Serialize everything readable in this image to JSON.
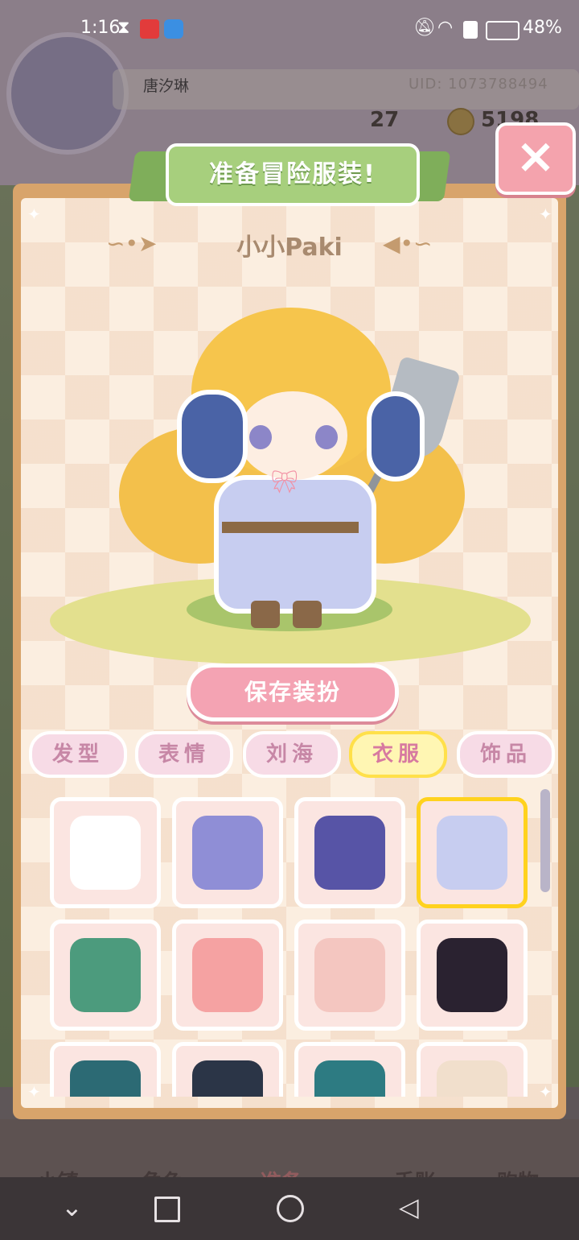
{
  "status_bar": {
    "time": "1:16",
    "battery": "48%"
  },
  "profile": {
    "username": "唐汐琳",
    "uid": "UID: 1073788494",
    "level": "27",
    "coins": "5198"
  },
  "dialog": {
    "title": "准备冒险服装!",
    "character_name": "小小Paki",
    "save_label": "保存装扮",
    "close_label": "×"
  },
  "tabs": [
    {
      "label": "发型",
      "active": false
    },
    {
      "label": "表情",
      "active": false
    },
    {
      "label": "刘海",
      "active": false
    },
    {
      "label": "衣服",
      "active": true
    },
    {
      "label": "饰品",
      "active": false
    }
  ],
  "outfits": [
    {
      "name": "white-dress",
      "color": "#ffffff",
      "selected": false
    },
    {
      "name": "cat-hood-dress",
      "color": "#8f8ed6",
      "selected": false
    },
    {
      "name": "blue-skirt-outfit",
      "color": "#5754a6",
      "selected": false
    },
    {
      "name": "blue-winter-coat",
      "color": "#c7cdf0",
      "selected": true
    },
    {
      "name": "green-purple-suit",
      "color": "#4c9b7d",
      "selected": false
    },
    {
      "name": "pink-cake-dress",
      "color": "#f5a2a2",
      "selected": false
    },
    {
      "name": "rose-cream-outfit",
      "color": "#f4c6c0",
      "selected": false
    },
    {
      "name": "black-red-suit",
      "color": "#2a2230",
      "selected": false
    },
    {
      "name": "teal-jacket",
      "color": "#2c6a74",
      "selected": false
    },
    {
      "name": "leopard-jacket",
      "color": "#2b3547",
      "selected": false
    },
    {
      "name": "teal-lace-dress",
      "color": "#2d7b82",
      "selected": false
    },
    {
      "name": "cream-dress",
      "color": "#f1dfcc",
      "selected": false
    }
  ],
  "bottom_nav": [
    {
      "label": "小镇"
    },
    {
      "label": "角色"
    },
    {
      "label": "准备"
    },
    {
      "label": "手账"
    },
    {
      "label": "购物"
    }
  ],
  "colors": {
    "accent_pink": "#f4a3b3",
    "ribbon_green": "#a7cf7d",
    "panel_frame": "#d8a46b",
    "selected_border": "#ffd21e"
  }
}
